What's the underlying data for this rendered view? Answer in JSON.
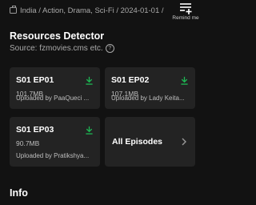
{
  "meta": {
    "text": "India / Action, Drama, Sci-Fi / 2024-01-01 /",
    "icon": "tv-icon"
  },
  "remind": {
    "label": "Remind me",
    "icon": "playlist-add-icon"
  },
  "resources": {
    "title": "Resources Detector",
    "source": "Source: fzmovies.cms etc.",
    "help_icon": "?",
    "episodes": [
      {
        "title": "S01 EP01",
        "size": "101.7MB",
        "uploader": "Uploaded by PaaQueci ..."
      },
      {
        "title": "S01 EP02",
        "size": "107.1MB",
        "uploader": "Uploaded by Lady Keita..."
      },
      {
        "title": "S01 EP03",
        "size": "90.7MB",
        "uploader": "Uploaded by Pratikshya..."
      }
    ],
    "all_episodes_label": "All Episodes"
  },
  "info": {
    "title": "Info"
  },
  "colors": {
    "background": "#121212",
    "card": "#232323",
    "download_accent": "#1db954"
  }
}
